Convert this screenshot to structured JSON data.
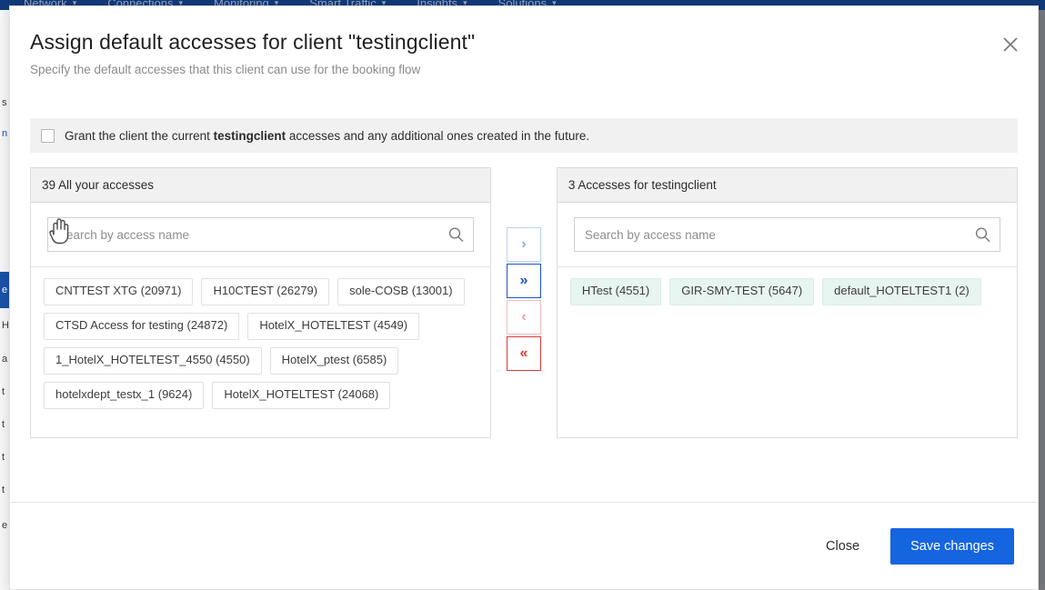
{
  "background": {
    "navbar": {
      "items": [
        {
          "label": "Network",
          "caret": "chevron-down-icon"
        },
        {
          "label": "Connections",
          "caret": "chevron-down-icon"
        },
        {
          "label": "Monitoring",
          "caret": "chevron-down-icon"
        },
        {
          "label": "Smart Traffic",
          "caret": "chevron-down-icon"
        },
        {
          "label": "Insights",
          "caret": "chevron-down-icon"
        },
        {
          "label": "Solutions",
          "caret": "chevron-down-icon"
        }
      ]
    },
    "left_strip_fragments": [
      "s",
      "n",
      "e",
      "H",
      "a",
      "t",
      "t",
      "t",
      "t",
      "e"
    ]
  },
  "modal": {
    "title": "Assign default accesses for client \"testingclient\"",
    "subtitle": "Specify the default accesses that this client can use for the booking flow",
    "close_icon": "close-icon",
    "grant": {
      "checked": false,
      "text_before": "Grant the client the current ",
      "text_bold": "testingclient",
      "text_after": " accesses and any additional ones created in the future."
    },
    "left_panel": {
      "header": "39 All your accesses",
      "count": 39,
      "search_placeholder": "Search by access name",
      "search_value": "",
      "search_icon": "search-icon",
      "chips": [
        "CNTTEST XTG (20971)",
        "H10CTEST (26279)",
        "sole-COSB (13001)",
        "CTSD Access for testing (24872)",
        "HotelX_HOTELTEST (4549)",
        "1_HotelX_HOTELTEST_4550 (4550)",
        "HotelX_ptest (6585)",
        "hotelxdept_testx_1 (9624)",
        "HotelX_HOTELTEST (24068)"
      ]
    },
    "transfer_buttons": [
      {
        "name": "move-selected-right-button",
        "glyph": "›",
        "style": "blue-faint"
      },
      {
        "name": "move-all-right-button",
        "glyph": "»",
        "style": "blue-solid"
      },
      {
        "name": "move-selected-left-button",
        "glyph": "‹",
        "style": "red-faint"
      },
      {
        "name": "move-all-left-button",
        "glyph": "«",
        "style": "red-solid"
      }
    ],
    "right_panel": {
      "header": "3 Accesses for testingclient",
      "count": 3,
      "search_placeholder": "Search by access name",
      "search_value": "",
      "search_icon": "search-icon",
      "chips": [
        "HTest (4551)",
        "GIR-SMY-TEST (5647)",
        "default_HOTELTEST1 (2)"
      ]
    },
    "footer": {
      "close_label": "Close",
      "save_label": "Save changes"
    }
  },
  "colors": {
    "navbar_bg": "#123a7a",
    "primary_button": "#1565e0",
    "panel_header_bg": "#f1f1f1",
    "selected_chip_bg": "#e7f4ef",
    "arrow_blue": "#1b54c9",
    "arrow_red": "#d93b3b"
  }
}
